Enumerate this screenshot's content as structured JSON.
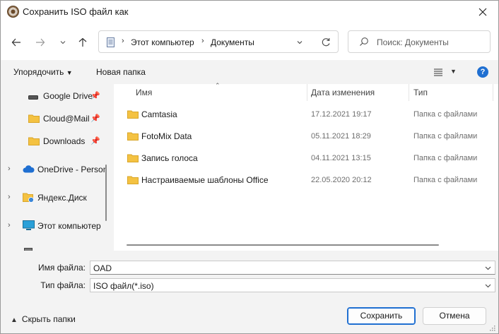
{
  "window": {
    "title": "Сохранить ISO файл как"
  },
  "nav": {
    "breadcrumb": [
      "Этот компьютер",
      "Документы"
    ],
    "search_placeholder": "Поиск: Документы"
  },
  "commands": {
    "organize": "Упорядочить",
    "new_folder": "Новая папка"
  },
  "sidebar": {
    "items": [
      {
        "label": "Google Drive",
        "icon": "drive-icon",
        "pinned": true,
        "expandable": false
      },
      {
        "label": "Cloud@Mail",
        "icon": "folder-icon",
        "pinned": true,
        "expandable": false
      },
      {
        "label": "Downloads",
        "icon": "folder-icon",
        "pinned": true,
        "expandable": false
      },
      {
        "label": "OneDrive - Personal",
        "icon": "cloud-icon",
        "pinned": false,
        "expandable": true
      },
      {
        "label": "Яндекс.Диск",
        "icon": "yandex-disk-icon",
        "pinned": false,
        "expandable": true
      },
      {
        "label": "Этот компьютер",
        "icon": "computer-icon",
        "pinned": false,
        "expandable": true
      }
    ]
  },
  "filelist": {
    "columns": [
      "Имя",
      "Дата изменения",
      "Тип"
    ],
    "rows": [
      {
        "name": "Camtasia",
        "date": "17.12.2021 19:17",
        "type": "Папка с файлами"
      },
      {
        "name": "FotoMix Data",
        "date": "05.11.2021 18:29",
        "type": "Папка с файлами"
      },
      {
        "name": "Запись голоса",
        "date": "04.11.2021 13:15",
        "type": "Папка с файлами"
      },
      {
        "name": "Настраиваемые шаблоны Office",
        "date": "22.05.2020 20:12",
        "type": "Папка с файлами"
      }
    ]
  },
  "fields": {
    "filename_label": "Имя файла:",
    "filename_value": "OAD",
    "filetype_label": "Тип файла:",
    "filetype_value": "ISO файл(*.iso)"
  },
  "footer": {
    "hide_folders": "Скрыть папки",
    "save": "Сохранить",
    "cancel": "Отмена"
  },
  "colors": {
    "accent": "#1f6fd1",
    "folder": "#f4c242"
  }
}
